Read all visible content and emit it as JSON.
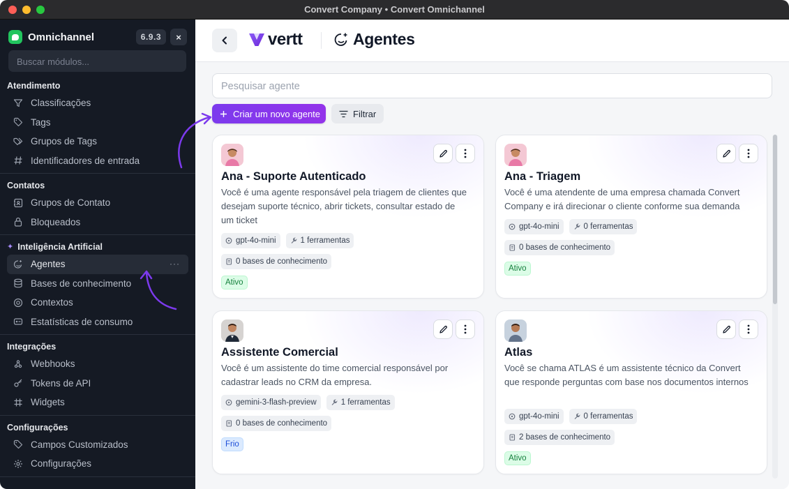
{
  "window": {
    "title": "Convert Company • Convert Omnichannel"
  },
  "sidebar": {
    "app_name": "Omnichannel",
    "version": "6.9.3",
    "close_label": "×",
    "search_placeholder": "Buscar módulos...",
    "sections": [
      {
        "title": "Atendimento",
        "items": [
          {
            "label": "Classificações",
            "icon": "filter-icon"
          },
          {
            "label": "Tags",
            "icon": "tag-icon"
          },
          {
            "label": "Grupos de Tags",
            "icon": "tags-icon"
          },
          {
            "label": "Identificadores de entrada",
            "icon": "hash-icon"
          }
        ]
      },
      {
        "title": "Contatos",
        "items": [
          {
            "label": "Grupos de Contato",
            "icon": "contact-group-icon"
          },
          {
            "label": "Bloqueados",
            "icon": "lock-icon"
          }
        ]
      },
      {
        "title": "Inteligência Artificial",
        "items": [
          {
            "label": "Agentes",
            "icon": "agent-icon",
            "active": true
          },
          {
            "label": "Bases de conhecimento",
            "icon": "database-icon"
          },
          {
            "label": "Contextos",
            "icon": "context-icon"
          },
          {
            "label": "Estatísticas de consumo",
            "icon": "gauge-icon"
          }
        ]
      },
      {
        "title": "Integrações",
        "items": [
          {
            "label": "Webhooks",
            "icon": "webhook-icon"
          },
          {
            "label": "Tokens de API",
            "icon": "key-icon"
          },
          {
            "label": "Widgets",
            "icon": "widget-hash-icon"
          }
        ]
      },
      {
        "title": "Configurações",
        "items": [
          {
            "label": "Campos Customizados",
            "icon": "tag-icon"
          },
          {
            "label": "Configurações",
            "icon": "gear-icon"
          }
        ]
      }
    ]
  },
  "header": {
    "brand": "vertt",
    "title": "Agentes"
  },
  "toolbar": {
    "search_placeholder": "Pesquisar agente",
    "new_agent_label": "Criar um novo agente",
    "filter_label": "Filtrar"
  },
  "agents": [
    {
      "name": "Ana - Suporte Autenticado",
      "description": "Você é uma agente responsável pela triagem de clientes que desejam suporte técnico, abrir tickets, consultar estado de um ticket",
      "model": "gpt-4o-mini",
      "tools": "1 ferramentas",
      "knowledge": "0 bases de conhecimento",
      "status": "Ativo",
      "status_kind": "ativo"
    },
    {
      "name": "Ana - Triagem",
      "description": "Você é uma atendente de uma empresa chamada Convert Company e irá direcionar o cliente conforme sua demanda",
      "model": "gpt-4o-mini",
      "tools": "0 ferramentas",
      "knowledge": "0 bases de conhecimento",
      "status": "Ativo",
      "status_kind": "ativo"
    },
    {
      "name": "Assistente Comercial",
      "description": "Você é um assistente do time comercial responsável por cadastrar leads no CRM da empresa.",
      "model": "gemini-3-flash-preview",
      "tools": "1 ferramentas",
      "knowledge": "0 bases de conhecimento",
      "status": "Frio",
      "status_kind": "frio"
    },
    {
      "name": "Atlas",
      "description": "Você se chama ATLAS é um assistente técnico da Convert que responde perguntas com base nos documentos internos",
      "model": "gpt-4o-mini",
      "tools": "0 ferramentas",
      "knowledge": "2 bases de conhecimento",
      "status": "Ativo",
      "status_kind": "ativo"
    }
  ],
  "colors": {
    "accent": "#7c3aed",
    "sidebar_bg": "#151a24",
    "status_active": "#15803d",
    "status_cold": "#1d4ed8"
  }
}
